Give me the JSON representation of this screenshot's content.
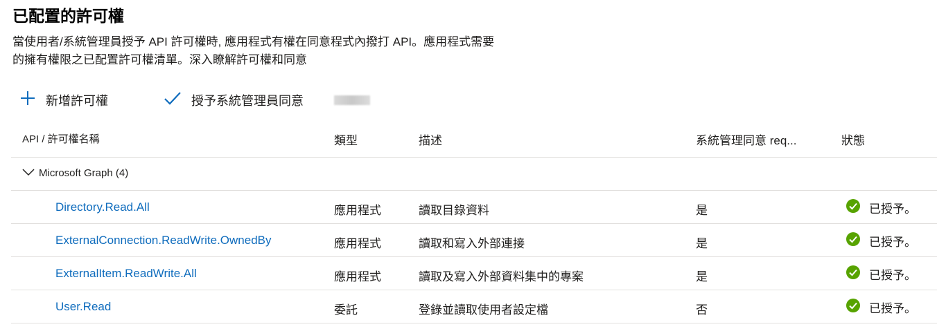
{
  "page": {
    "title": "已配置的許可權",
    "description_line1": "當使用者/系統管理員授予 API 許可權時, 應用程式有權在同意程式內撥打 API。應用程式需要",
    "description_line2": "的擁有權限之已配置許可權清單。深入瞭解許可權和同意"
  },
  "toolbar": {
    "add_label": "新增許可權",
    "grant_label": "授予系統管理員同意"
  },
  "table": {
    "headers": {
      "name": "API / 許可權名稱",
      "type": "類型",
      "description": "描述",
      "admin_consent": "系統管理同意 req...",
      "status": "狀態"
    },
    "group_label": "Microsoft Graph (4)",
    "rows": [
      {
        "name": "Directory.Read.All",
        "type": "應用程式",
        "description": "讀取目錄資料",
        "admin": "是",
        "status": "已授予。"
      },
      {
        "name": "ExternalConnection.ReadWrite.OwnedBy",
        "type": "應用程式",
        "description": "讀取和寫入外部連接",
        "admin": "是",
        "status": "已授予。"
      },
      {
        "name": "ExternalItem.ReadWrite.All",
        "type": "應用程式",
        "description": "讀取及寫入外部資料集中的專案",
        "admin": "是",
        "status": "已授予。"
      },
      {
        "name": "User.Read",
        "type": "委託",
        "description": "登錄並讀取使用者設定檔",
        "admin": "否",
        "status": "已授予。"
      }
    ]
  },
  "icons": {
    "add": "plus-icon",
    "grant": "checkmark-icon",
    "expand": "chevron-down-icon",
    "status": "success-check-icon"
  },
  "colors": {
    "link": "#0f6cbd",
    "success": "#57a300",
    "divider": "#e1dfdd"
  }
}
